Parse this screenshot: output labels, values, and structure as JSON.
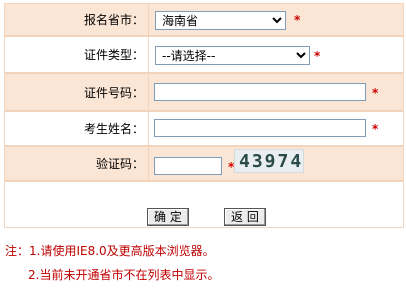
{
  "fields": {
    "province": {
      "label": "报名省市：",
      "value": "海南省",
      "required_mark": "*"
    },
    "id_type": {
      "label": "证件类型：",
      "value": "--请选择--",
      "required_mark": "*"
    },
    "id_number": {
      "label": "证件号码：",
      "value": "",
      "required_mark": "*"
    },
    "name": {
      "label": "考生姓名：",
      "value": "",
      "required_mark": "*"
    },
    "captcha": {
      "label": "验证码：",
      "value": "",
      "required_mark": "*",
      "image_text": "43974"
    }
  },
  "buttons": {
    "confirm": "确 定",
    "back": "返 回"
  },
  "notes": {
    "prefix": "注：",
    "line1": "1.请使用IE8.0及更高版本浏览器。",
    "line2": "2.当前未开通省市不在列表中显示。"
  },
  "colors": {
    "row_shade": "#fbe6d6",
    "border": "#f2d3bb",
    "required": "#cc0000",
    "note_text": "#c00000"
  }
}
